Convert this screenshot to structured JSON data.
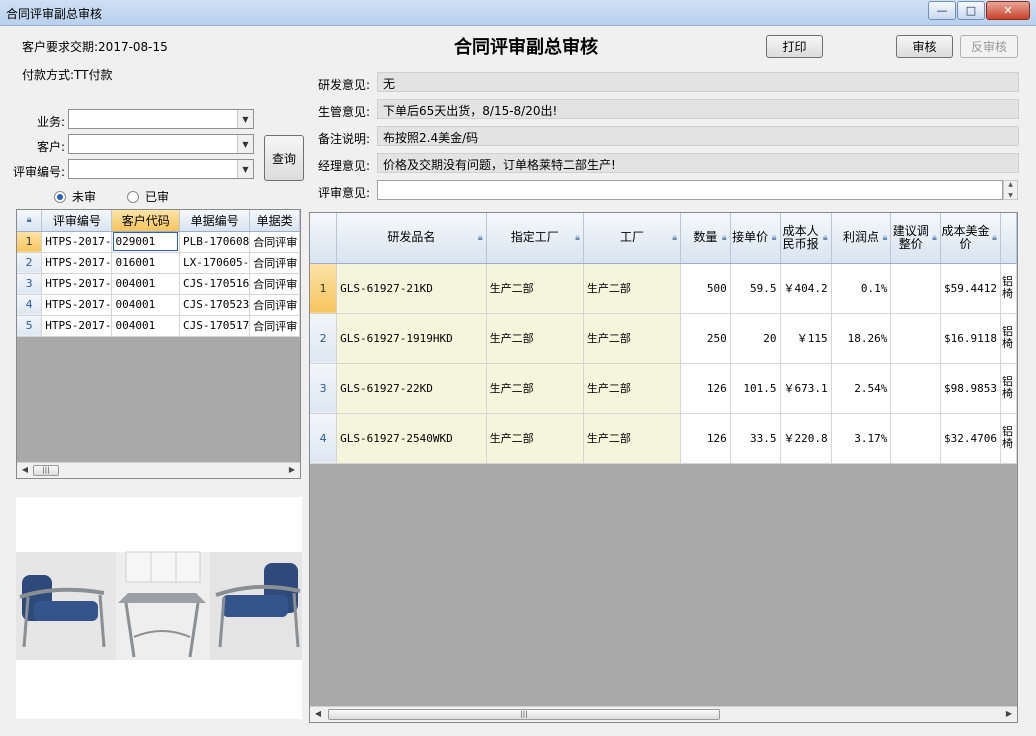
{
  "window": {
    "title": "合同评审副总审核",
    "min": "—",
    "max": "□",
    "close": "✕"
  },
  "header": {
    "title": "合同评审副总审核",
    "delivery": "客户要求交期:2017-08-15",
    "payment": "付款方式:TT付款",
    "print": "打印",
    "approve": "审核",
    "unapprove": "反审核"
  },
  "filters": {
    "business_label": "业务:",
    "customer_label": "客户:",
    "review_no_label": "评审编号:",
    "query": "查询",
    "unreviewed": "未审",
    "reviewed": "已审"
  },
  "opinions": [
    {
      "label": "研发意见:",
      "value": "无"
    },
    {
      "label": "生管意见:",
      "value": "下单后65天出货，8/15-8/20出!"
    },
    {
      "label": "备注说明:",
      "value": "布按照2.4美金/码"
    },
    {
      "label": "经理意见:",
      "value": "价格及交期没有问题，订单格莱特二部生产!"
    }
  ],
  "review_opinion_label": "评审意见:",
  "left_grid": {
    "columns": [
      "评审编号",
      "客户代码",
      "单据编号",
      "单据类"
    ],
    "rows": [
      [
        "1",
        "HTPS-2017-",
        "029001",
        "PLB-170608",
        "合同评审"
      ],
      [
        "2",
        "HTPS-2017-",
        "016001",
        "LX-170605-",
        "合同评审"
      ],
      [
        "3",
        "HTPS-2017-",
        "004001",
        "CJS-170516",
        "合同评审"
      ],
      [
        "4",
        "HTPS-2017-",
        "004001",
        "CJS-170523",
        "合同评审"
      ],
      [
        "5",
        "HTPS-2017-",
        "004001",
        "CJS-170517",
        "合同评审"
      ]
    ]
  },
  "right_grid": {
    "columns": [
      "研发品名",
      "指定工厂",
      "工厂",
      "数量",
      "接单价",
      "成本人民币报",
      "利润点",
      "建议调整价",
      "成本美金价"
    ],
    "rows": [
      [
        "1",
        "GLS-61927-21KD",
        "生产二部",
        "生产二部",
        "500",
        "59.5",
        "￥404.2",
        "0.1%",
        "",
        "$59.4412",
        "铝椅"
      ],
      [
        "2",
        "GLS-61927-1919HKD",
        "生产二部",
        "生产二部",
        "250",
        "20",
        "￥115",
        "18.26%",
        "",
        "$16.9118",
        "铝椅"
      ],
      [
        "3",
        "GLS-61927-22KD",
        "生产二部",
        "生产二部",
        "126",
        "101.5",
        "￥673.1",
        "2.54%",
        "",
        "$98.9853",
        "铝椅"
      ],
      [
        "4",
        "GLS-61927-2540WKD",
        "生产二部",
        "生产二部",
        "126",
        "33.5",
        "￥220.8",
        "3.17%",
        "",
        "$32.4706",
        "铝椅"
      ]
    ]
  },
  "colors": {
    "title_bar": "#b9d1ee",
    "selected_header": "#f6c45c",
    "highlight_cell": "#f5f5dc",
    "grid_empty": "#a9a9a9"
  }
}
